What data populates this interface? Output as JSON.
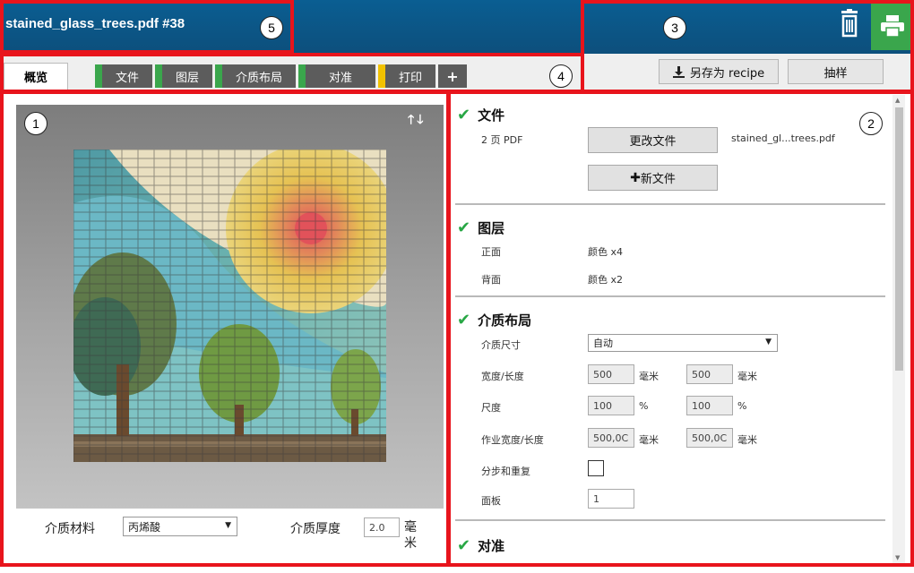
{
  "window": {
    "title": "stained_glass_trees.pdf #38"
  },
  "callouts": [
    "1",
    "2",
    "3",
    "4",
    "5"
  ],
  "tabs": [
    {
      "label": "概览",
      "active": true
    },
    {
      "label": "文件",
      "color": "#3aa64c"
    },
    {
      "label": "图层",
      "color": "#3aa64c"
    },
    {
      "label": "介质布局",
      "color": "#3aa64c"
    },
    {
      "label": "对准",
      "color": "#3aa64c"
    },
    {
      "label": "打印",
      "color": "#f2c200"
    }
  ],
  "add_tab_label": "+",
  "toolbar": {
    "save_recipe_label": "另存为 recipe",
    "sample_label": "抽样"
  },
  "preview": {
    "media_material_label": "介质材料",
    "media_material_value": "丙烯酸",
    "media_thickness_label": "介质厚度",
    "media_thickness_value": "2.0",
    "media_thickness_unit": "毫米"
  },
  "file_section": {
    "title": "文件",
    "pages": "2 页 PDF",
    "change_file_label": "更改文件",
    "file_name": "stained_gl...trees.pdf",
    "new_file_label": "新文件"
  },
  "layers_section": {
    "title": "图层",
    "front_label": "正面",
    "front_value": "颜色 x4",
    "back_label": "背面",
    "back_value": "颜色 x2"
  },
  "layout_section": {
    "title": "介质布局",
    "media_size_label": "介质尺寸",
    "media_size_value": "自动",
    "width_length_label": "宽度/长度",
    "width_value": "500",
    "length_value": "500",
    "unit_mm": "毫米",
    "scale_label": "尺度",
    "scale_x": "100",
    "scale_y": "100",
    "unit_percent": "%",
    "job_size_label": "作业宽度/长度",
    "job_width": "500,0C",
    "job_length": "500,0C",
    "step_repeat_label": "分步和重复",
    "panels_label": "面板",
    "panels_value": "1"
  },
  "registration_section": {
    "title": "对准"
  },
  "colors": {
    "accent_green": "#3aa64c",
    "print_tab": "#f2c200",
    "highlight": "#e8141c",
    "titlebar": "#0d5a8c"
  }
}
